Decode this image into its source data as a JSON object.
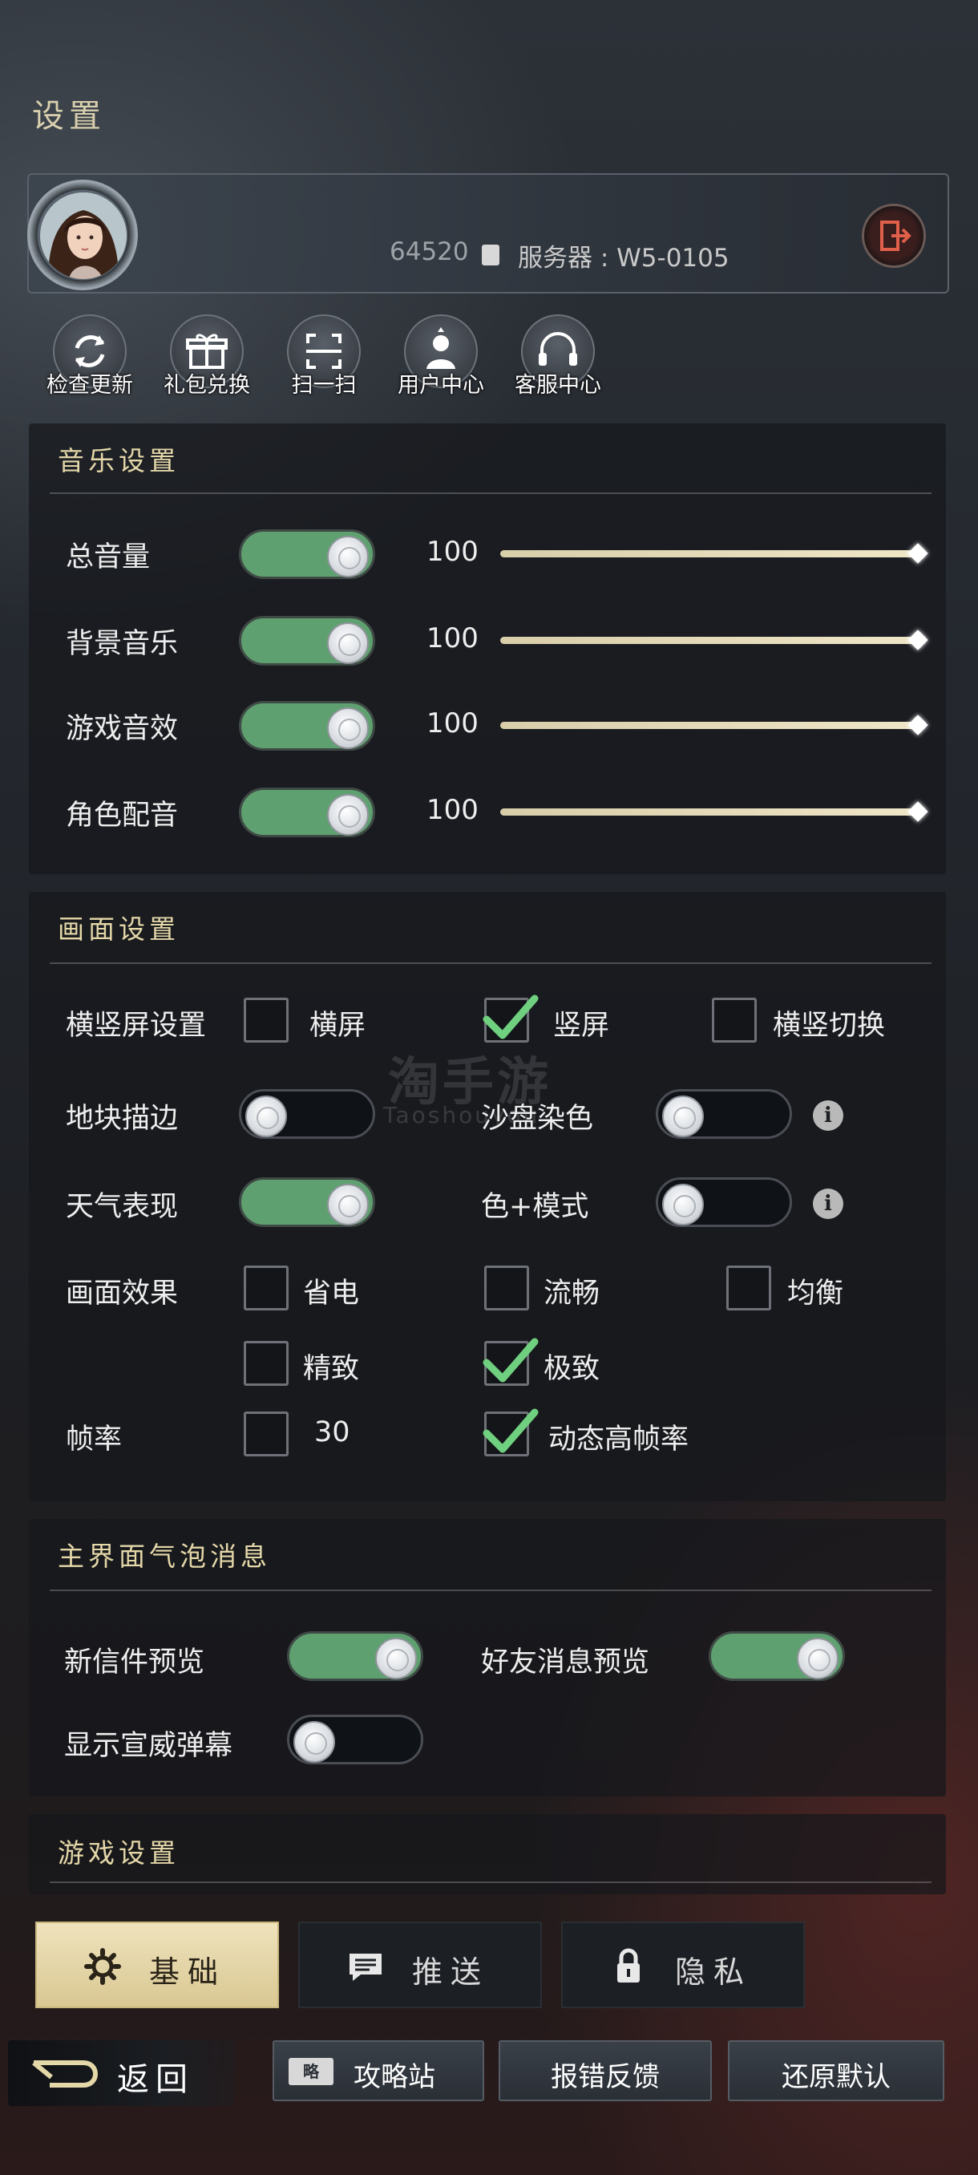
{
  "page": {
    "title": "设置"
  },
  "profile": {
    "user_id": "64520",
    "server": "服务器 : W5-0105"
  },
  "quick_actions": [
    {
      "label": "检查更新",
      "icon": "refresh-icon"
    },
    {
      "label": "礼包兑换",
      "icon": "gift-icon"
    },
    {
      "label": "扫一扫",
      "icon": "scan-icon"
    },
    {
      "label": "用户中心",
      "icon": "user-icon"
    },
    {
      "label": "客服中心",
      "icon": "headset-icon"
    }
  ],
  "music": {
    "title": "音乐设置",
    "rows": [
      {
        "label": "总音量",
        "value": "100",
        "enabled": true,
        "level": 1.0
      },
      {
        "label": "背景音乐",
        "value": "100",
        "enabled": true,
        "level": 1.0
      },
      {
        "label": "游戏音效",
        "value": "100",
        "enabled": true,
        "level": 1.0
      },
      {
        "label": "角色配音",
        "value": "100",
        "enabled": true,
        "level": 1.0
      }
    ]
  },
  "display": {
    "title": "画面设置",
    "orientation": {
      "label": "横竖屏设置",
      "options": [
        {
          "label": "横屏",
          "checked": false
        },
        {
          "label": "竖屏",
          "checked": true
        },
        {
          "label": "横竖切换",
          "checked": false
        }
      ]
    },
    "tile_outline": {
      "label": "地块描边",
      "enabled": false
    },
    "sand_color": {
      "label": "沙盘染色",
      "enabled": false
    },
    "weather": {
      "label": "天气表现",
      "enabled": true
    },
    "color_mode": {
      "label": "色+模式",
      "enabled": false
    },
    "effects": {
      "label": "画面效果",
      "options": [
        {
          "label": "省电",
          "checked": false
        },
        {
          "label": "流畅",
          "checked": false
        },
        {
          "label": "均衡",
          "checked": false
        },
        {
          "label": "精致",
          "checked": false
        },
        {
          "label": "极致",
          "checked": true
        }
      ]
    },
    "framerate": {
      "label": "帧率",
      "options": [
        {
          "label": "30",
          "checked": false
        },
        {
          "label": "动态高帧率",
          "checked": true
        }
      ]
    }
  },
  "bubble": {
    "title": "主界面气泡消息",
    "mail_preview": {
      "label": "新信件预览",
      "enabled": true
    },
    "friend_preview": {
      "label": "好友消息预览",
      "enabled": true
    },
    "barrage": {
      "label": "显示宣威弹幕",
      "enabled": false
    }
  },
  "game": {
    "title": "游戏设置"
  },
  "tabs": [
    {
      "label": "基础",
      "icon": "gear-icon",
      "active": true
    },
    {
      "label": "推送",
      "icon": "message-icon",
      "active": false
    },
    {
      "label": "隐私",
      "icon": "lock-icon",
      "active": false
    }
  ],
  "footer": {
    "back": "返回",
    "guide_tag": "略",
    "guide": "攻略站",
    "report": "报错反馈",
    "reset": "还原默认"
  },
  "watermark": {
    "main": "淘手游",
    "sub": "Taoshouyou"
  },
  "colors": {
    "toggle_on": "#5fa070",
    "accent_gold": "#e4d7a8",
    "active_tab": "#e6d8ab"
  }
}
